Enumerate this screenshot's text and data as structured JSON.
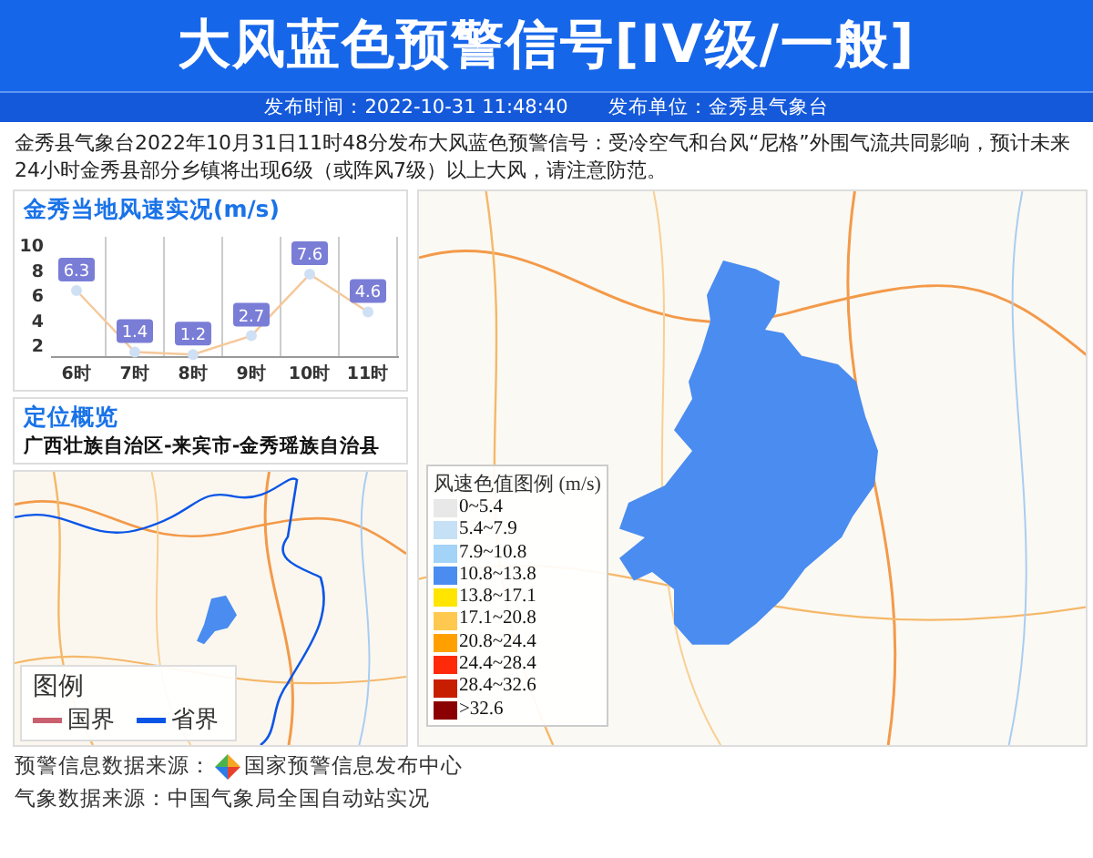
{
  "header": {
    "title": "大风蓝色预警信号[IV级/一般]",
    "publish_time": "发布时间：2022-10-31 11:48:40",
    "publisher": "发布单位：金秀县气象台"
  },
  "description": "金秀县气象台2022年10月31日11时48分发布大风蓝色预警信号：受冷空气和台风“尼格”外围气流共同影响，预计未来24小时金秀县部分乡镇将出现6级（或阵风7级）以上大风，请注意防范。",
  "wind_panel": {
    "title": "金秀当地风速实况(m/s)",
    "chart_data": {
      "type": "line",
      "categories": [
        "6时",
        "7时",
        "8时",
        "9时",
        "10时",
        "11时"
      ],
      "series": [
        {
          "color": "#f5c89a",
          "marker": "circle",
          "values": [
            6.3,
            1.4,
            1.2,
            2.7,
            7.6,
            4.6
          ]
        }
      ],
      "ylim": [
        1,
        10
      ],
      "yticks": [
        2,
        4,
        6,
        8,
        10
      ],
      "data_labels": true
    }
  },
  "location": {
    "title": "定位概览",
    "path": "广西壮族自治区-来宾市-金秀瑶族自治县"
  },
  "overview_map": {
    "legend_title": "图例",
    "legend": [
      {
        "label": "国界",
        "color": "#c9606e"
      },
      {
        "label": "省界",
        "color": "#0a55e6"
      }
    ]
  },
  "wind_map": {
    "legend_title": "风速色值图例",
    "legend_unit": "(m/s)",
    "legend": [
      {
        "label": "0~5.4",
        "color": "#e8e8e8"
      },
      {
        "label": "5.4~7.9",
        "color": "#c6e0f5"
      },
      {
        "label": "7.9~10.8",
        "color": "#a3d3f7"
      },
      {
        "label": "10.8~13.8",
        "color": "#4a8cf0"
      },
      {
        "label": "13.8~17.1",
        "color": "#ffe500"
      },
      {
        "label": "17.1~20.8",
        "color": "#ffc94f"
      },
      {
        "label": "20.8~24.4",
        "color": "#ffa000"
      },
      {
        "label": "24.4~28.4",
        "color": "#ff2a0a"
      },
      {
        "label": "28.4~32.6",
        "color": "#c81e00"
      },
      {
        "label": ">32.6",
        "color": "#8b0000"
      }
    ]
  },
  "footer": {
    "warning_source_label": "预警信息数据来源：",
    "warning_source": "国家预警信息发布中心",
    "weather_source": "气象数据来源：中国气象局全国自动站实况"
  }
}
